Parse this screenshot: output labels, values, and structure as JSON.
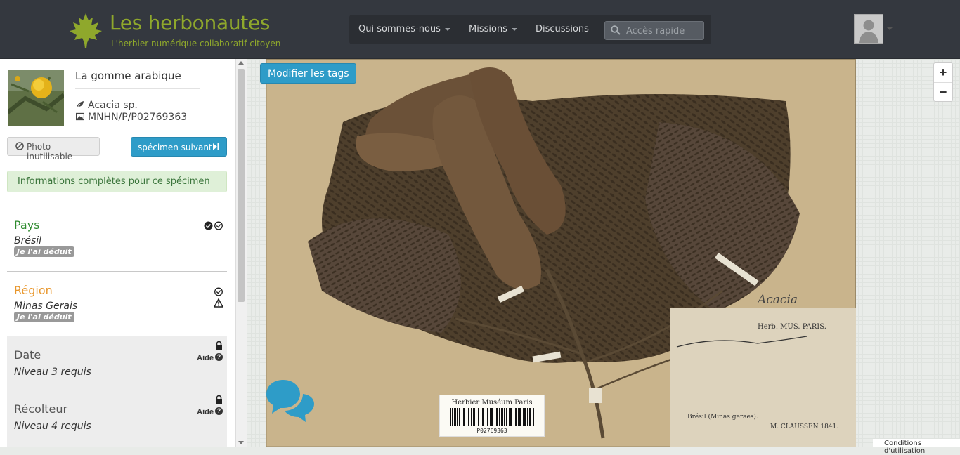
{
  "header": {
    "title": "Les herbonautes",
    "subtitle": "L'herbier numérique collaboratif citoyen",
    "nav": {
      "about": "Qui sommes-nous",
      "missions": "Missions",
      "discussions": "Discussions"
    },
    "search_placeholder": "Accès rapide"
  },
  "sidebar": {
    "mission_title": "La gomme arabique",
    "species": "Acacia sp.",
    "specimen_code": "MNHN/P/P02769363",
    "photo_button": "Photo inutilisable",
    "next_button": "spécimen suivant",
    "complete_message": "Informations complètes pour ce spécimen",
    "fields": [
      {
        "label": "Pays",
        "value": "Brésil",
        "badge": "Je l'ai déduit",
        "color": "#2e8b2e",
        "status": "validated"
      },
      {
        "label": "Région",
        "value": "Minas Gerais",
        "badge": "Je l'ai déduit",
        "color": "#e8962b",
        "status": "warning"
      },
      {
        "label": "Date",
        "value": "Niveau 3 requis",
        "help": "Aide",
        "status": "locked"
      },
      {
        "label": "Récolteur",
        "value": "Niveau 4 requis",
        "help": "Aide",
        "status": "locked"
      }
    ]
  },
  "viewer": {
    "tags_button": "Modifier les tags",
    "zoom_in": "+",
    "zoom_out": "−",
    "barcode_header": "Herbier Muséum Paris",
    "barcode_number": "P02769363",
    "label_lines": [
      "Herb. MUS. PARIS.",
      "Acacia",
      "Brésil (Minas geraes).",
      "M. CLAUSSEN 1841."
    ]
  },
  "footer": {
    "terms": "Conditions d'utilisation"
  },
  "colors": {
    "header_bg": "#34383f",
    "brand_green": "#8fa82c",
    "primary_button": "#2e9cc8",
    "success_bg": "#dff0d8"
  }
}
